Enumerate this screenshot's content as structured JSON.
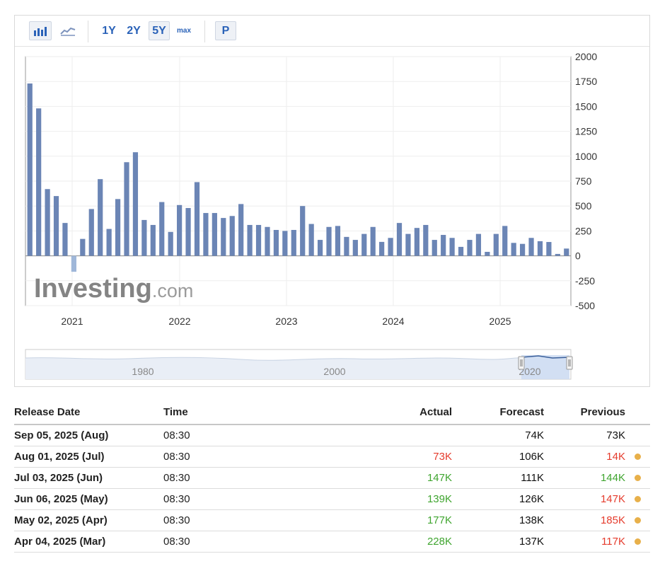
{
  "toolbar": {
    "ranges": [
      "1Y",
      "2Y",
      "5Y",
      "max"
    ],
    "active_range": "5Y",
    "p_label": "P",
    "chart_mode": "bar"
  },
  "colors": {
    "bar": "#6b85b5",
    "bar_negative": "#9fb7d9",
    "actual_green": "#3fa52f",
    "actual_red": "#e53b2c",
    "dot": "#e8b04a"
  },
  "watermark": {
    "brand": "Investing",
    "suffix": ".com"
  },
  "chart_data": {
    "type": "bar",
    "title": "",
    "xlabel": "",
    "ylabel": "",
    "ylim": [
      -500,
      2000
    ],
    "yticks": [
      2000,
      1750,
      1500,
      1250,
      1000,
      750,
      500,
      250,
      0,
      -250,
      -500
    ],
    "x_tick_labels": [
      "2021",
      "2022",
      "2023",
      "2024",
      "2025"
    ],
    "grid": true,
    "values": [
      1730,
      1480,
      670,
      600,
      330,
      -160,
      170,
      470,
      770,
      270,
      570,
      940,
      1040,
      360,
      310,
      540,
      240,
      510,
      480,
      740,
      430,
      430,
      380,
      400,
      520,
      310,
      310,
      290,
      260,
      250,
      260,
      500,
      320,
      160,
      290,
      300,
      190,
      160,
      220,
      290,
      140,
      180,
      330,
      220,
      280,
      310,
      160,
      210,
      180,
      90,
      160,
      220,
      40,
      220,
      300,
      130,
      120,
      180,
      147,
      139,
      19,
      73
    ]
  },
  "navigator": {
    "labels": [
      "1980",
      "2000",
      "2020"
    ]
  },
  "table": {
    "headers": {
      "date": "Release Date",
      "time": "Time",
      "actual": "Actual",
      "forecast": "Forecast",
      "previous": "Previous"
    },
    "rows": [
      {
        "date": "Sep 05, 2025 (Aug)",
        "time": "08:30",
        "actual": "",
        "actual_color": "",
        "forecast": "74K",
        "previous": "73K",
        "previous_color": "#111111",
        "dot": false
      },
      {
        "date": "Aug 01, 2025 (Jul)",
        "time": "08:30",
        "actual": "73K",
        "actual_color": "#e53b2c",
        "forecast": "106K",
        "previous": "14K",
        "previous_color": "#e53b2c",
        "dot": true
      },
      {
        "date": "Jul 03, 2025 (Jun)",
        "time": "08:30",
        "actual": "147K",
        "actual_color": "#3fa52f",
        "forecast": "111K",
        "previous": "144K",
        "previous_color": "#3fa52f",
        "dot": true
      },
      {
        "date": "Jun 06, 2025 (May)",
        "time": "08:30",
        "actual": "139K",
        "actual_color": "#3fa52f",
        "forecast": "126K",
        "previous": "147K",
        "previous_color": "#e53b2c",
        "dot": true
      },
      {
        "date": "May 02, 2025 (Apr)",
        "time": "08:30",
        "actual": "177K",
        "actual_color": "#3fa52f",
        "forecast": "138K",
        "previous": "185K",
        "previous_color": "#e53b2c",
        "dot": true
      },
      {
        "date": "Apr 04, 2025 (Mar)",
        "time": "08:30",
        "actual": "228K",
        "actual_color": "#3fa52f",
        "forecast": "137K",
        "previous": "117K",
        "previous_color": "#e53b2c",
        "dot": true
      }
    ]
  }
}
